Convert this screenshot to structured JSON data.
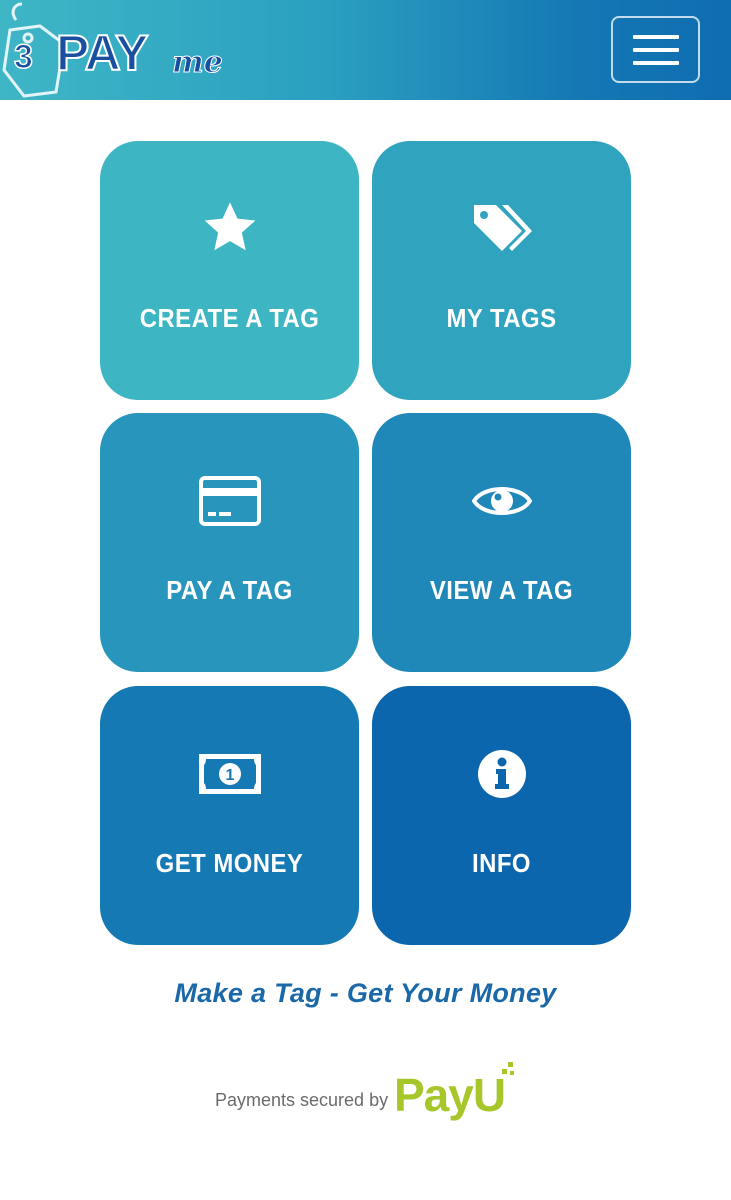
{
  "header": {
    "logo_prefix": "3",
    "logo_word": "PAY",
    "logo_suffix": "me",
    "menu_icon": "hamburger-menu-icon",
    "gradient": [
      "#3fb6c6",
      "#0f6db0"
    ]
  },
  "tiles": [
    {
      "label": "CREATE A TAG",
      "icon": "star-icon",
      "color": "#3db5c2"
    },
    {
      "label": "MY TAGS",
      "icon": "tags-icon",
      "color": "#30a3bf"
    },
    {
      "label": "PAY A TAG",
      "icon": "credit-card-icon",
      "color": "#2896bc"
    },
    {
      "label": "VIEW A TAG",
      "icon": "eye-icon",
      "color": "#1f88b8"
    },
    {
      "label": "GET MONEY",
      "icon": "money-bill-icon",
      "color": "#1579b3"
    },
    {
      "label": "INFO",
      "icon": "info-icon",
      "color": "#0b66ad"
    }
  ],
  "tagline": "Make a Tag - Get Your Money",
  "footer": {
    "secured_text": "Payments secured by",
    "brand": "PayU",
    "brand_color": "#a6c62a"
  }
}
